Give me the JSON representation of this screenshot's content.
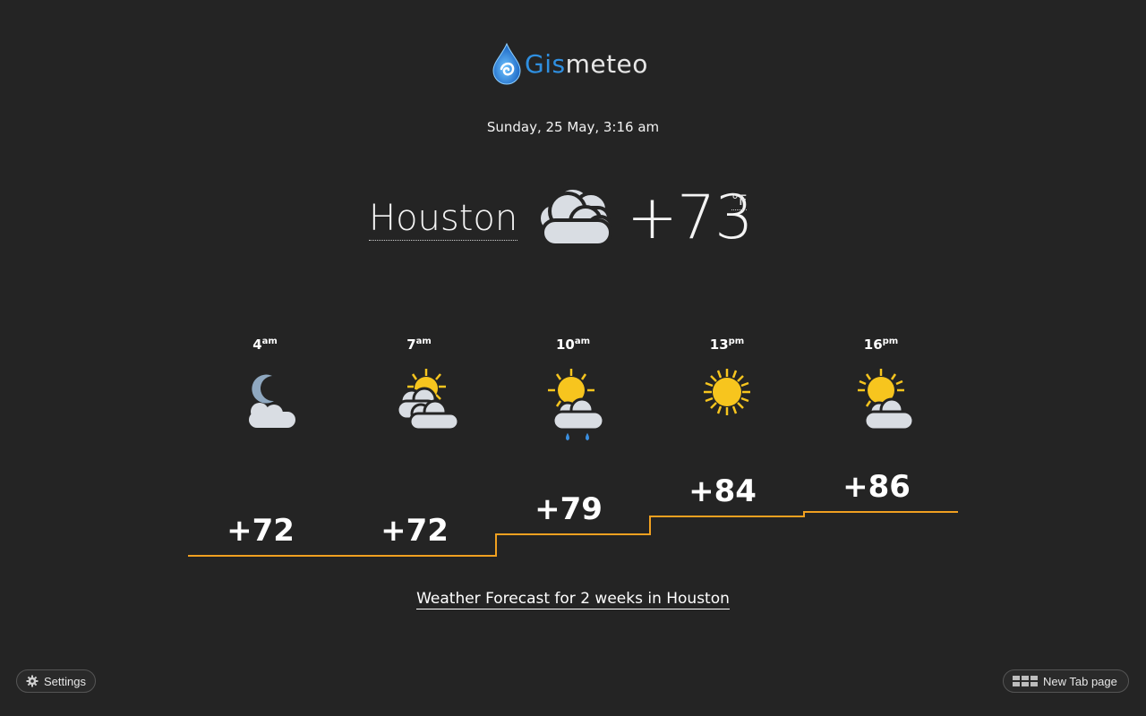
{
  "logo": {
    "gis": "Gis",
    "meteo": "meteo"
  },
  "date": "Sunday, 25 May, 3:16 am",
  "current": {
    "city": "Houston",
    "temperature": "+73",
    "unit": "°F",
    "icon": "cloudy-icon"
  },
  "hourly": [
    {
      "hour": "4",
      "period": "am",
      "temp": "+72",
      "icon": "moon-cloud-icon"
    },
    {
      "hour": "7",
      "period": "am",
      "temp": "+72",
      "icon": "sun-clouds-icon"
    },
    {
      "hour": "10",
      "period": "am",
      "temp": "+79",
      "icon": "sun-cloud-rain-icon"
    },
    {
      "hour": "13",
      "period": "pm",
      "temp": "+84",
      "icon": "sun-icon"
    },
    {
      "hour": "16",
      "period": "pm",
      "temp": "+86",
      "icon": "sun-cloud-icon"
    }
  ],
  "forecast_link": "Weather Forecast for 2 weeks in Houston",
  "buttons": {
    "settings": "Settings",
    "new_tab": "New Tab page"
  },
  "colors": {
    "background": "#242424",
    "graph_line": "#f0a020",
    "logo_blue": "#2f8fe0",
    "sun": "#f7c51e",
    "cloud": "#d9dde3"
  }
}
